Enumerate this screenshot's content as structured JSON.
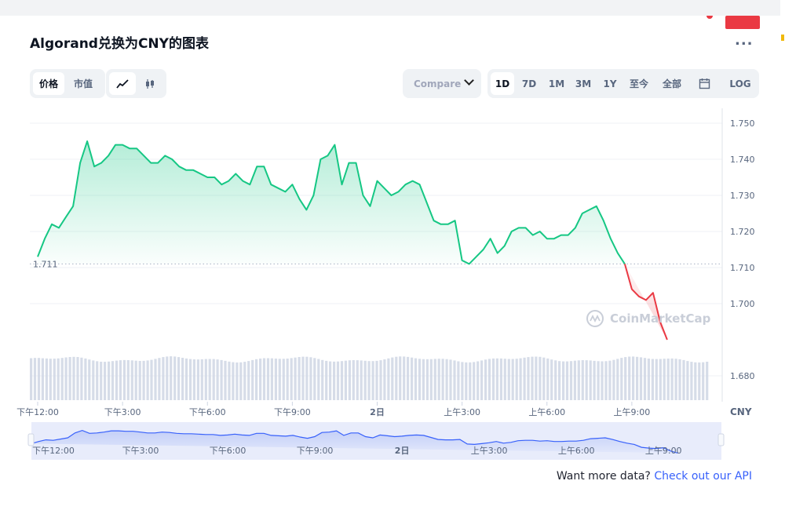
{
  "header": {
    "title": "Algorand兑换为CNY的图表",
    "more_label": "..."
  },
  "toggles": {
    "metric": [
      {
        "label": "价格",
        "active": true
      },
      {
        "label": "市值",
        "active": false
      }
    ],
    "chart_style": [
      {
        "icon": "line-chart-icon",
        "active": true
      },
      {
        "icon": "candlestick-icon",
        "active": false
      }
    ]
  },
  "compare": {
    "label": "Compare"
  },
  "ranges": [
    {
      "label": "1D",
      "active": true
    },
    {
      "label": "7D",
      "active": false
    },
    {
      "label": "1M",
      "active": false
    },
    {
      "label": "3M",
      "active": false
    },
    {
      "label": "1Y",
      "active": false
    },
    {
      "label": "至今",
      "active": false
    },
    {
      "label": "全部",
      "active": false
    },
    {
      "label": "",
      "icon": "calendar-icon",
      "active": false
    },
    {
      "label": "LOG",
      "active": false
    }
  ],
  "chart_data": {
    "type": "area",
    "y_ticks": [
      "1.750",
      "1.740",
      "1.730",
      "1.720",
      "1.710",
      "1.700",
      "1.680"
    ],
    "ylim": [
      1.67,
      1.754
    ],
    "x_tick_labels": [
      "下午12:00",
      "下午3:00",
      "下午6:00",
      "下午9:00",
      "2日",
      "上午3:00",
      "上午6:00",
      "上午9:00"
    ],
    "x_tick_hours": [
      0,
      3,
      6,
      9,
      12,
      15,
      18,
      21
    ],
    "currency_label": "CNY",
    "open_value": 1.711,
    "open_label": "1.711",
    "last_value": 1.69,
    "last_label": "1.690",
    "watermark": "CoinMarketCap",
    "colors": {
      "up": "#16c784",
      "down": "#ea3943",
      "volume": "#cfd6e4"
    },
    "series": [
      {
        "x_hours": [
          0,
          0.25,
          0.5,
          0.75,
          1,
          1.25,
          1.5,
          1.75,
          2,
          2.25,
          2.5,
          2.75,
          3,
          3.25,
          3.5,
          3.75,
          4,
          4.25,
          4.5,
          4.75,
          5,
          5.25,
          5.5,
          5.75,
          6,
          6.25,
          6.5,
          6.75,
          7,
          7.25,
          7.5,
          7.75,
          8,
          8.25,
          8.5,
          8.75,
          9,
          9.25,
          9.5,
          9.75,
          10,
          10.25,
          10.5,
          10.75,
          11,
          11.25,
          11.5,
          11.75,
          12,
          12.25,
          12.5,
          12.75,
          13,
          13.25,
          13.5,
          13.75,
          14,
          14.25,
          14.5,
          14.75,
          15,
          15.25,
          15.5,
          15.75,
          16,
          16.25,
          16.5,
          16.75,
          17,
          17.25,
          17.5,
          17.75,
          18,
          18.25,
          18.5,
          18.75,
          19,
          19.25,
          19.5,
          19.75,
          20,
          20.25,
          20.5,
          20.75,
          21,
          21.25,
          21.5,
          21.75,
          22,
          22.25,
          22.5,
          22.75,
          23,
          23.25,
          23.5,
          23.75
        ],
        "values": [
          1.713,
          1.718,
          1.722,
          1.721,
          1.724,
          1.727,
          1.739,
          1.745,
          1.738,
          1.739,
          1.741,
          1.744,
          1.744,
          1.743,
          1.743,
          1.741,
          1.739,
          1.739,
          1.741,
          1.74,
          1.738,
          1.737,
          1.737,
          1.736,
          1.735,
          1.735,
          1.733,
          1.734,
          1.736,
          1.734,
          1.733,
          1.738,
          1.738,
          1.733,
          1.732,
          1.731,
          1.733,
          1.729,
          1.726,
          1.73,
          1.74,
          1.741,
          1.744,
          1.733,
          1.739,
          1.739,
          1.73,
          1.727,
          1.734,
          1.732,
          1.73,
          1.731,
          1.733,
          1.734,
          1.733,
          1.728,
          1.723,
          1.722,
          1.722,
          1.723,
          1.712,
          1.711,
          1.713,
          1.715,
          1.718,
          1.714,
          1.716,
          1.72,
          1.721,
          1.721,
          1.719,
          1.72,
          1.718,
          1.718,
          1.719,
          1.719,
          1.721,
          1.725,
          1.726,
          1.727,
          1.723,
          1.718,
          1.714,
          1.711,
          1.704,
          1.702,
          1.701,
          1.703,
          1.695,
          1.69
        ]
      }
    ],
    "volume_note": "volume bars (relative heights, unitless)"
  },
  "navigator": {
    "labels": [
      "下午12:00",
      "下午3:00",
      "下午6:00",
      "下午9:00",
      "2日",
      "上午3:00",
      "上午6:00",
      "上午9:00"
    ]
  },
  "footer": {
    "text": "Want more data?",
    "link": "Check out our API"
  }
}
